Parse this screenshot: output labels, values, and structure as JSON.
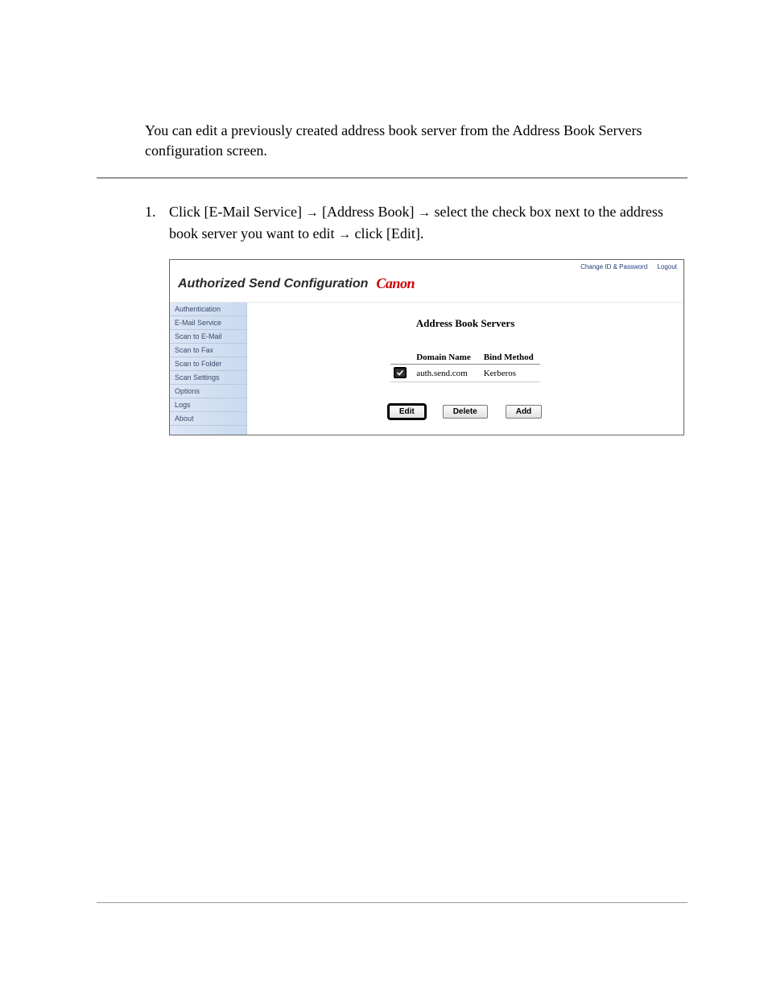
{
  "intro": "You can edit a previously created address book server from the Address Book Servers configuration screen.",
  "step": {
    "num": "1.",
    "parts": {
      "a": "Click [E-Mail Service] ",
      "arrow1": "→",
      "b": " [Address Book] ",
      "arrow2": "→",
      "c": " select the check box next to the address book server you want to edit ",
      "arrow3": "→",
      "d": " click [Edit]."
    }
  },
  "screenshot": {
    "top_links": {
      "change": "Change ID & Password",
      "logout": "Logout"
    },
    "brand_title": "Authorized Send Configuration",
    "brand_logo": "Canon",
    "sidebar": {
      "items": [
        "Authentication",
        "E-Mail Service",
        "Scan to E-Mail",
        "Scan to Fax",
        "Scan to Folder",
        "Scan Settings",
        "Options",
        "Logs",
        "About"
      ]
    },
    "panel": {
      "title": "Address Book Servers",
      "headers": {
        "domain": "Domain Name",
        "bind": "Bind Method"
      },
      "rows": [
        {
          "checked": true,
          "domain": "auth.send.com",
          "bind": "Kerberos"
        }
      ],
      "buttons": {
        "edit": "Edit",
        "delete": "Delete",
        "add": "Add"
      }
    }
  }
}
